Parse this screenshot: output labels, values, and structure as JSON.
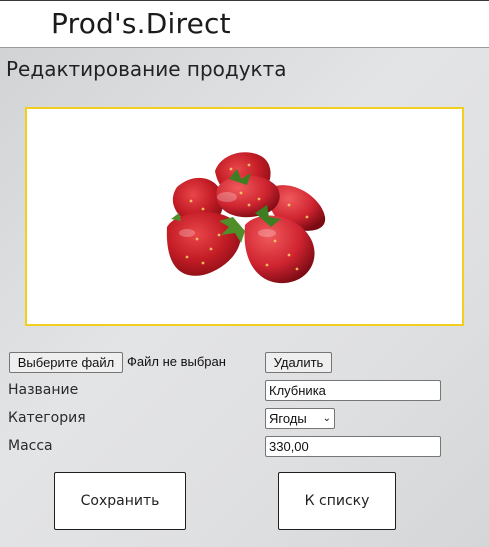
{
  "header": {
    "brand": "Prod's.Direct"
  },
  "page_title": "Редактирование продукта",
  "image": {
    "subject": "strawberries",
    "frame_color": "#f2cf1f"
  },
  "file_input": {
    "button_label": "Выберите файл",
    "status": "Файл не выбран"
  },
  "delete_label": "Удалить",
  "form": {
    "name_label": "Название",
    "name_value": "Клубника",
    "category_label": "Категория",
    "category_value": "Ягоды",
    "mass_label": "Масса",
    "mass_value": "330,00"
  },
  "actions": {
    "save_label": "Сохранить",
    "list_label": "К списку"
  }
}
